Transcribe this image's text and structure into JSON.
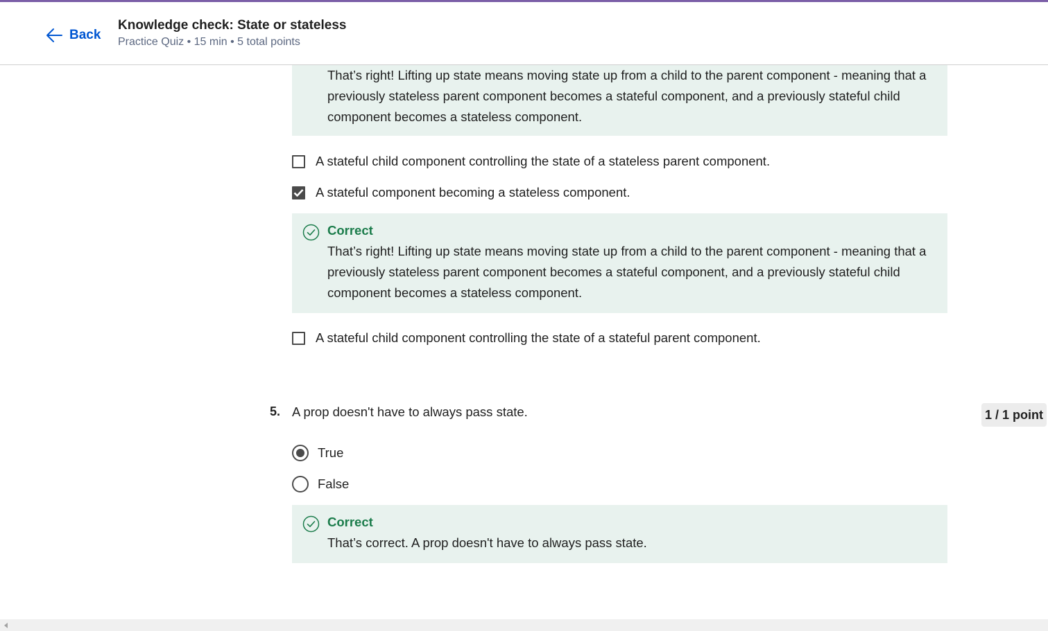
{
  "header": {
    "back_label": "Back",
    "title": "Knowledge check: State or stateless",
    "subtitle": "Practice Quiz • 15 min • 5 total points"
  },
  "question4": {
    "top_feedback": {
      "text": "That’s right! Lifting up state means moving state up from a child to the parent component - meaning that a previously stateless parent component becomes a stateful component, and a previously stateful child component becomes a stateless component."
    },
    "options": [
      {
        "label": "A stateful child component controlling the state of a stateless parent component.",
        "checked": false
      },
      {
        "label": "A stateful component becoming a stateless component.",
        "checked": true
      },
      {
        "label": "A stateful child component controlling the state of a stateful parent component.",
        "checked": false
      }
    ],
    "feedback": {
      "heading": "Correct",
      "text": "That’s right! Lifting up state means moving state up from a child to the parent component - meaning that a previously stateless parent component becomes a stateful component, and a previously stateful child component becomes a stateless component."
    }
  },
  "question5": {
    "number": "5.",
    "text": "A prop doesn't have to always pass state.",
    "points": "1 / 1 point",
    "options": [
      {
        "label": "True",
        "selected": true
      },
      {
        "label": "False",
        "selected": false
      }
    ],
    "feedback": {
      "heading": "Correct",
      "text": "That’s correct. A prop doesn't have to always pass state."
    }
  },
  "colors": {
    "accent_bar": "#7b5ea7",
    "link_blue": "#0056d2",
    "correct_green": "#1b7c4b",
    "feedback_bg": "#e8f2ee"
  }
}
